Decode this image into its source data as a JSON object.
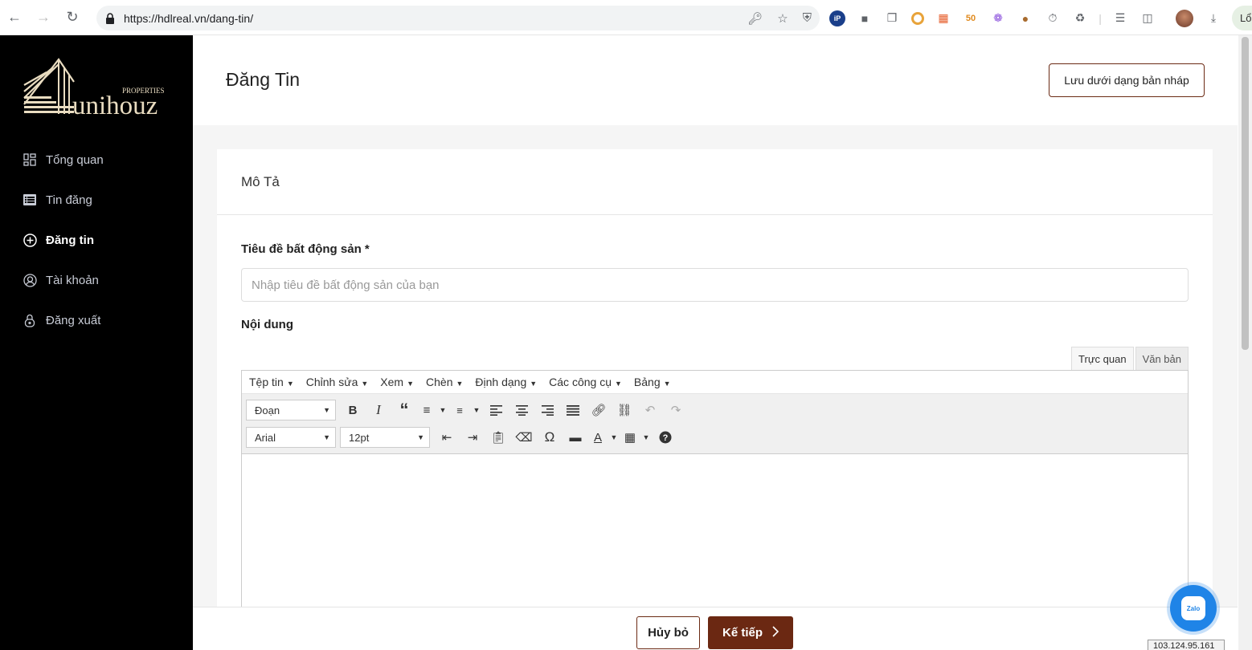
{
  "browser": {
    "url": "https://hdlreal.vn/dang-tin/",
    "lang_button": "Lổ"
  },
  "sidebar": {
    "logo_text": "unihouz",
    "logo_subtext": "PROPERTIES",
    "items": [
      {
        "label": "Tổng quan",
        "icon": "dashboard-icon"
      },
      {
        "label": "Tin đăng",
        "icon": "list-icon"
      },
      {
        "label": "Đăng tin",
        "icon": "plus-circle-icon"
      },
      {
        "label": "Tài khoản",
        "icon": "user-circle-icon"
      },
      {
        "label": "Đăng xuất",
        "icon": "lock-icon"
      }
    ]
  },
  "header": {
    "title": "Đăng Tin",
    "draft_button": "Lưu dưới dạng bản nháp"
  },
  "card": {
    "section_title": "Mô Tả",
    "title_label": "Tiêu đề bất động sản *",
    "title_placeholder": "Nhập tiêu đề bất động sản của bạn",
    "content_label": "Nội dung"
  },
  "editor": {
    "tabs": [
      "Trực quan",
      "Văn bản"
    ],
    "menu": [
      "Tệp tin",
      "Chỉnh sửa",
      "Xem",
      "Chèn",
      "Định dạng",
      "Các công cụ",
      "Bảng"
    ],
    "block_format": "Đoạn",
    "font_family": "Arial",
    "font_size": "12pt"
  },
  "footer": {
    "cancel": "Hủy bỏ",
    "next": "Kế tiếp"
  },
  "ip_badge": "103.124.95.161",
  "colors": {
    "accent": "#6b2812",
    "sidebar_bg": "#000000",
    "zalo": "#1f84e7"
  }
}
